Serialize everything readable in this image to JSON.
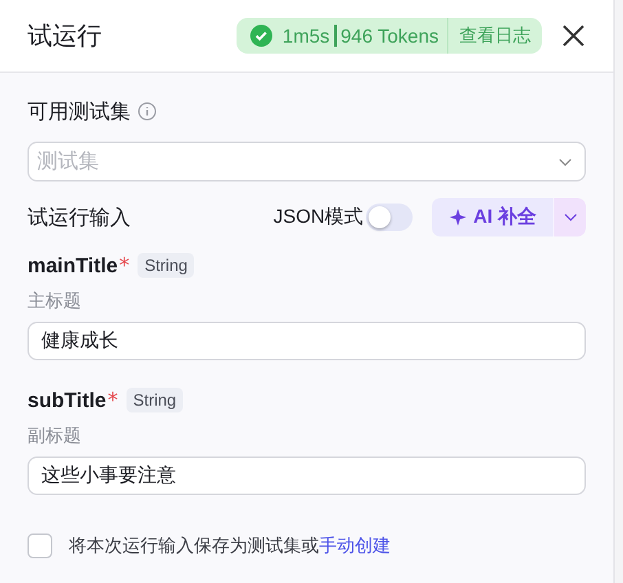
{
  "header": {
    "title": "试运行",
    "succeeded": true,
    "duration": "1m5s",
    "tokens": "946 Tokens",
    "log_link": "查看日志"
  },
  "test_set": {
    "label": "可用测试集",
    "placeholder": "测试集"
  },
  "input_section": {
    "title": "试运行输入",
    "json_mode": {
      "label": "JSON模式",
      "on": false
    },
    "ai_button": "AI 补全"
  },
  "fields": [
    {
      "name": "mainTitle",
      "required_mark": "*",
      "type": "String",
      "description": "主标题",
      "value": "健康成长"
    },
    {
      "name": "subTitle",
      "required_mark": "*",
      "type": "String",
      "description": "副标题",
      "value": "这些小事要注意"
    }
  ],
  "save_option": {
    "checked": false,
    "text": "将本次运行输入保存为测试集或",
    "link": "手动创建"
  }
}
